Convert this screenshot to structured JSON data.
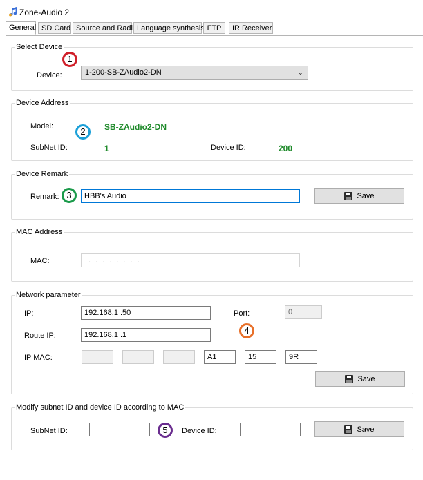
{
  "window": {
    "title": "Zone-Audio 2",
    "icon": "music-note-icon"
  },
  "tabs": [
    {
      "label": "General",
      "active": true
    },
    {
      "label": "SD Card"
    },
    {
      "label": "Source and Radio"
    },
    {
      "label": "Language synthesis"
    },
    {
      "label": "FTP"
    },
    {
      "label": "IR Receiver"
    }
  ],
  "select_device": {
    "title": "Select Device",
    "device_label": "Device:",
    "device_value": "1-200-SB-ZAudio2-DN"
  },
  "device_address": {
    "title": "Device Address",
    "model_label": "Model:",
    "model_value": "SB-ZAudio2-DN",
    "subnet_label": "SubNet ID:",
    "subnet_value": "1",
    "device_id_label": "Device ID:",
    "device_id_value": "200"
  },
  "device_remark": {
    "title": "Device Remark",
    "remark_label": "Remark:",
    "remark_value": "HBB's Audio",
    "save_label": "Save"
  },
  "mac_address": {
    "title": "MAC Address",
    "mac_label": "MAC:",
    "mac_value": ". . . . . . . ."
  },
  "network": {
    "title": "Network parameter",
    "ip_label": "IP:",
    "ip_value": "192.168.1  .50",
    "port_label": "Port:",
    "port_value": "0",
    "route_label": "Route IP:",
    "route_value": "192.168.1  .1",
    "ipmac_label": "IP MAC:",
    "ipmac_values": [
      "",
      "",
      "",
      "A1",
      "15",
      "9R"
    ],
    "save_label": "Save"
  },
  "modify": {
    "title": "Modify subnet ID and device ID according to MAC",
    "subnet_label": "SubNet ID:",
    "subnet_value": "",
    "device_id_label": "Device ID:",
    "device_id_value": "",
    "save_label": "Save"
  },
  "annotations": [
    {
      "label": "1",
      "color": "#d0202a"
    },
    {
      "label": "2",
      "color": "#1ba0d8"
    },
    {
      "label": "3",
      "color": "#1a9a4a"
    },
    {
      "label": "4",
      "color": "#e8702a"
    },
    {
      "label": "5",
      "color": "#6a2d8f"
    }
  ]
}
